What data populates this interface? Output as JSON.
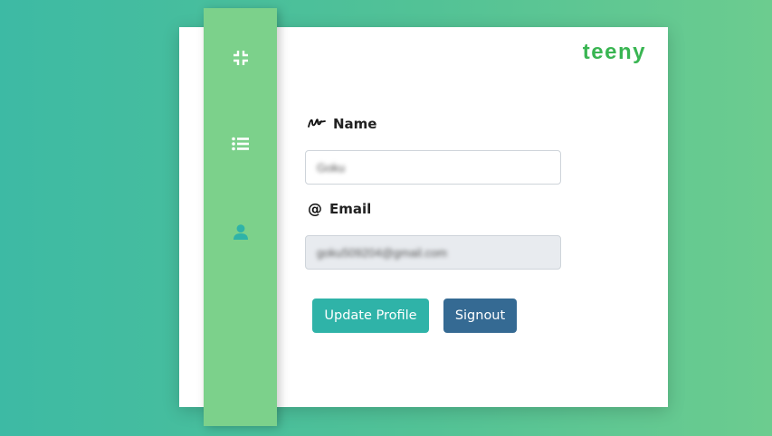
{
  "brand": "teeny",
  "sidebar": {
    "items": [
      {
        "icon": "compress-icon"
      },
      {
        "icon": "list-icon"
      },
      {
        "icon": "user-icon",
        "active": true
      }
    ]
  },
  "form": {
    "name_label": "Name",
    "name_icon": "signature-icon",
    "name_value": "Goku",
    "email_label": "Email",
    "email_icon": "at-icon",
    "email_value": "goku509204@gmail.com"
  },
  "buttons": {
    "update": "Update Profile",
    "signout": "Signout"
  },
  "colors": {
    "brand": "#39b552",
    "sidebar": "#7cd18b",
    "active_icon": "#2fb3a8",
    "update_button": "#2fb3a8",
    "signout_button": "#356a93"
  }
}
